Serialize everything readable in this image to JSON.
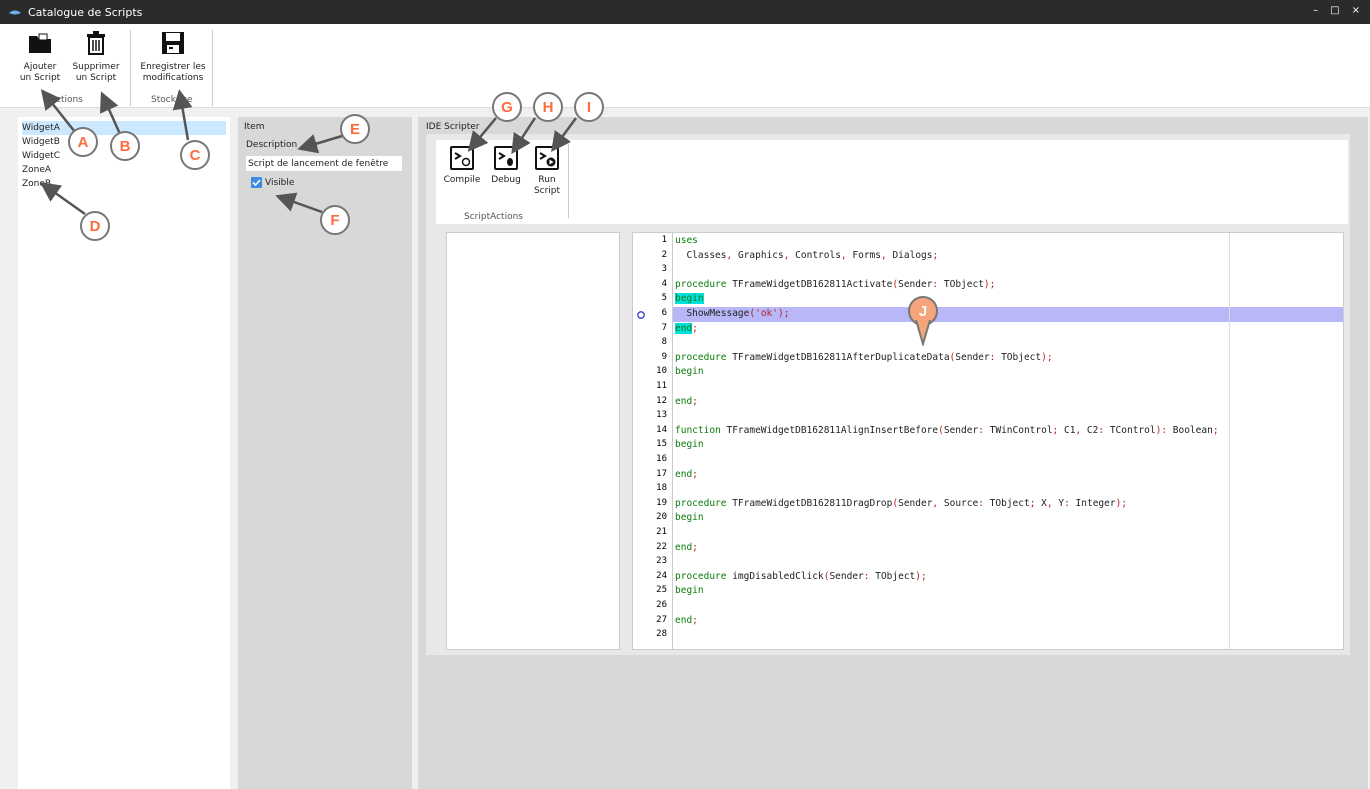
{
  "window": {
    "title": "Catalogue de Scripts"
  },
  "ribbon": {
    "add_label_1": "Ajouter",
    "add_label_2": "un Script",
    "delete_label_1": "Supprimer",
    "delete_label_2": "un Script",
    "save_label_1": "Enregistrer les",
    "save_label_2": "modifications",
    "group_actions": "Actions",
    "group_storage": "Stockage"
  },
  "list": {
    "items": [
      "WidgetA",
      "WidgetB",
      "WidgetC",
      "ZoneA",
      "ZoneB"
    ],
    "selected": "WidgetA"
  },
  "item_panel": {
    "title": "Item",
    "description_label": "Description",
    "description_value": "Script de lancement de fenêtre",
    "visible_label": "Visible",
    "visible_checked": true
  },
  "ide": {
    "title": "IDE Scripter",
    "compile_label": "Compile",
    "debug_label": "Debug",
    "run_label_1": "Run",
    "run_label_2": "Script",
    "group_label": "ScriptActions",
    "code_lines": [
      "uses",
      "  Classes, Graphics, Controls, Forms, Dialogs;",
      "",
      "procedure TFrameWidgetDB162811Activate(Sender: TObject);",
      "begin",
      "  ShowMessage('ok');",
      "end;",
      "",
      "procedure TFrameWidgetDB162811AfterDuplicateData(Sender: TObject);",
      "begin",
      "",
      "end;",
      "",
      "function TFrameWidgetDB162811AlignInsertBefore(Sender: TWinControl; C1, C2: TControl): Boolean;",
      "begin",
      "",
      "end;",
      "",
      "procedure TFrameWidgetDB162811DragDrop(Sender, Source: TObject; X, Y: Integer);",
      "begin",
      "",
      "end;",
      "",
      "procedure imgDisabledClick(Sender: TObject);",
      "begin",
      "",
      "end;",
      ""
    ],
    "current_line": 6
  },
  "callouts": [
    "A",
    "B",
    "C",
    "D",
    "E",
    "F",
    "G",
    "H",
    "I",
    "J"
  ],
  "colors": {
    "selection": "#cce8ff",
    "exec_line": "#b8b8f8",
    "keyword": "#0a7d0a",
    "string": "#b22222",
    "callout": "#f6a47b"
  }
}
